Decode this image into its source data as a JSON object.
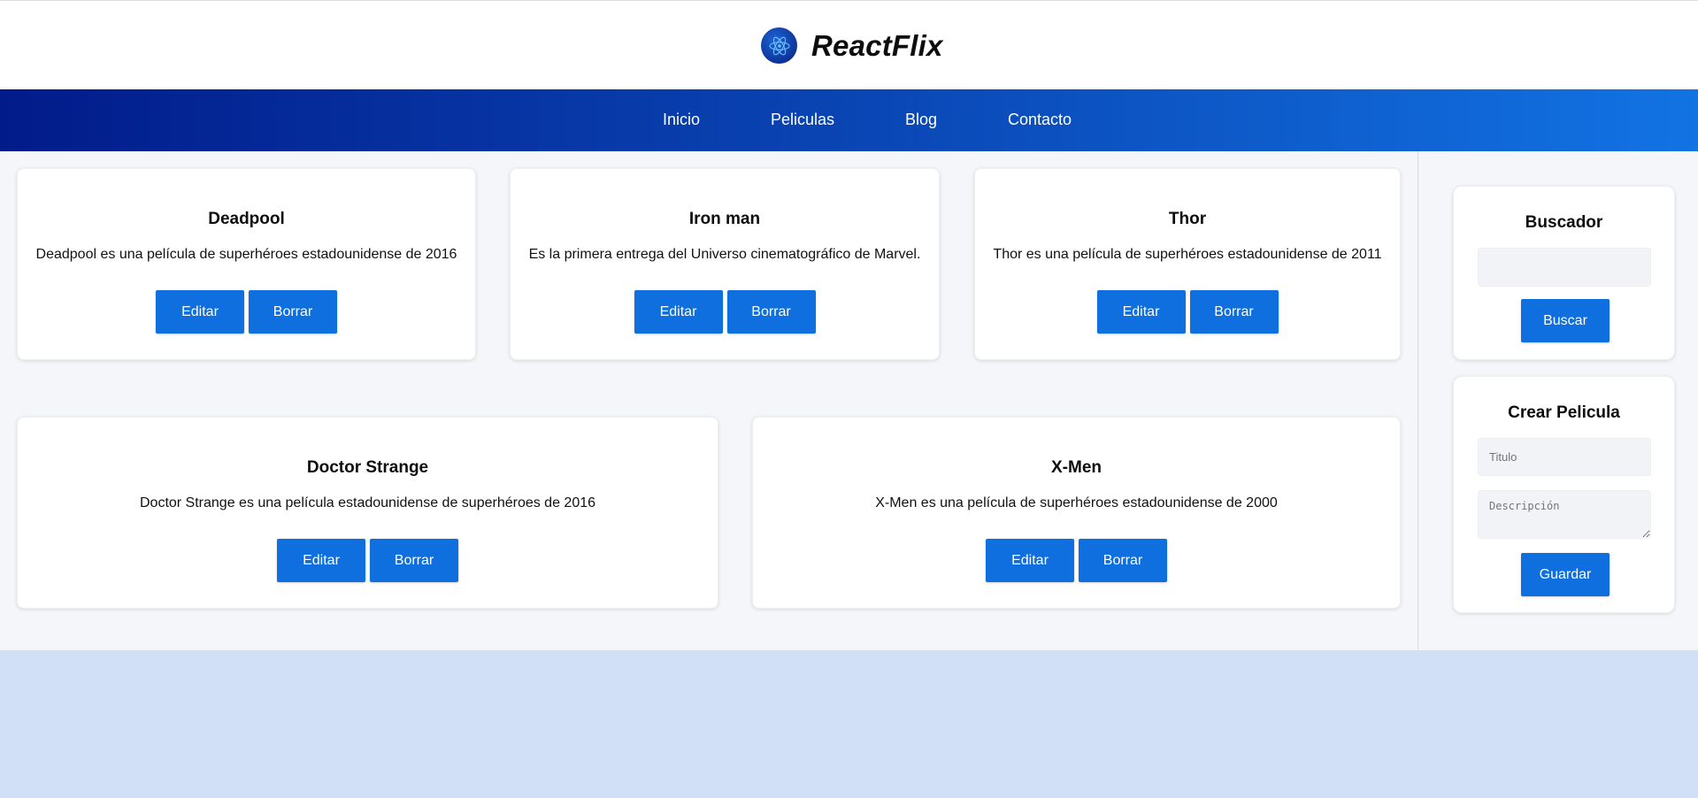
{
  "brand": {
    "name": "ReactFlix",
    "logo_icon": "react-atom-icon"
  },
  "nav": {
    "items": [
      "Inicio",
      "Peliculas",
      "Blog",
      "Contacto"
    ]
  },
  "movies": [
    {
      "title": "Deadpool",
      "description": "Deadpool es una película de superhéroes estadounidense de 2016",
      "edit_label": "Editar",
      "delete_label": "Borrar"
    },
    {
      "title": "Iron man",
      "description": "Es la primera entrega del Universo cinematográfico de Marvel.",
      "edit_label": "Editar",
      "delete_label": "Borrar"
    },
    {
      "title": "Thor",
      "description": "Thor es una película de superhéroes estadounidense de 2011",
      "edit_label": "Editar",
      "delete_label": "Borrar"
    },
    {
      "title": "Doctor Strange",
      "description": "Doctor Strange es una película estadounidense de superhéroes de 2016",
      "edit_label": "Editar",
      "delete_label": "Borrar"
    },
    {
      "title": "X-Men",
      "description": "X-Men es una película de superhéroes estadounidense de 2000",
      "edit_label": "Editar",
      "delete_label": "Borrar"
    }
  ],
  "sidebar": {
    "search": {
      "title": "Buscador",
      "value": "",
      "placeholder": "",
      "button_label": "Buscar"
    },
    "create": {
      "title": "Crear Pelicula",
      "title_placeholder": "Titulo",
      "description_placeholder": "Descripción",
      "button_label": "Guardar"
    }
  },
  "colors": {
    "primary": "#0f6fde",
    "nav_start": "#021b8a",
    "nav_end": "#1273e3",
    "page_bg": "#f4f6f9",
    "footer_bg": "#d1dff7"
  }
}
